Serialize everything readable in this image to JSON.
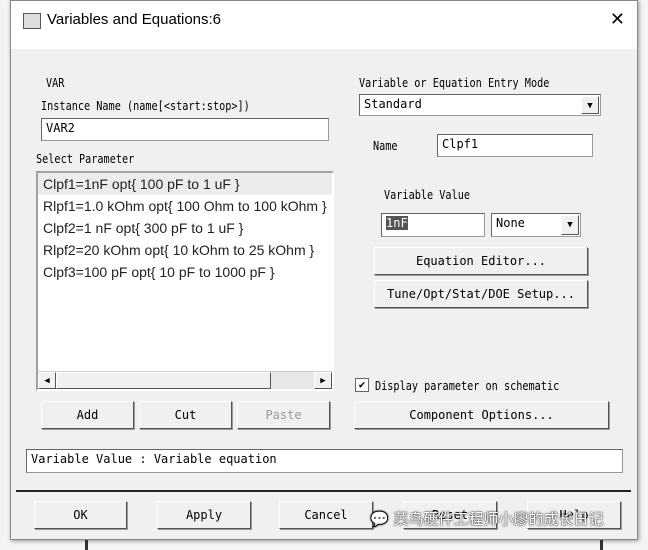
{
  "window": {
    "title": "Variables and Equations:6",
    "close_icon": "close-icon"
  },
  "component": {
    "type_label": "VAR",
    "instance_label": "Instance Name  (name[<start:stop>])",
    "instance_value": "VAR2"
  },
  "parameters": {
    "label": "Select Parameter",
    "items": [
      "Clpf1=1nF opt{ 100 pF to 1 uF }",
      "Rlpf1=1.0 kOhm opt{ 100 Ohm to 100 kOhm }",
      "Clpf2=1 nF opt{ 300 pF to 1 uF }",
      "Rlpf2=20 kOhm opt{ 10 kOhm to 25 kOhm }",
      "Clpf3=100 pF opt{ 10 pF to 1000 pF }"
    ],
    "selected_index": 0
  },
  "entry_mode": {
    "label": "Variable or Equation Entry Mode",
    "value": "Standard"
  },
  "name": {
    "label": "Name",
    "value": "Clpf1"
  },
  "variable_value": {
    "label": "Variable Value",
    "value": "1nF",
    "unit": "None"
  },
  "buttons": {
    "equation_editor": "Equation Editor...",
    "tune": "Tune/Opt/Stat/DOE Setup...",
    "add": "Add",
    "cut": "Cut",
    "paste": "Paste",
    "component_options": "Component Options...",
    "ok": "OK",
    "apply": "Apply",
    "cancel": "Cancel",
    "reset": "Reset",
    "help": "Help"
  },
  "display_checkbox": {
    "label": "Display parameter on schematic",
    "checked": true
  },
  "status": "Variable Value : Variable equation",
  "watermark": "菜鸟硬件工程师小廖的成长日记"
}
